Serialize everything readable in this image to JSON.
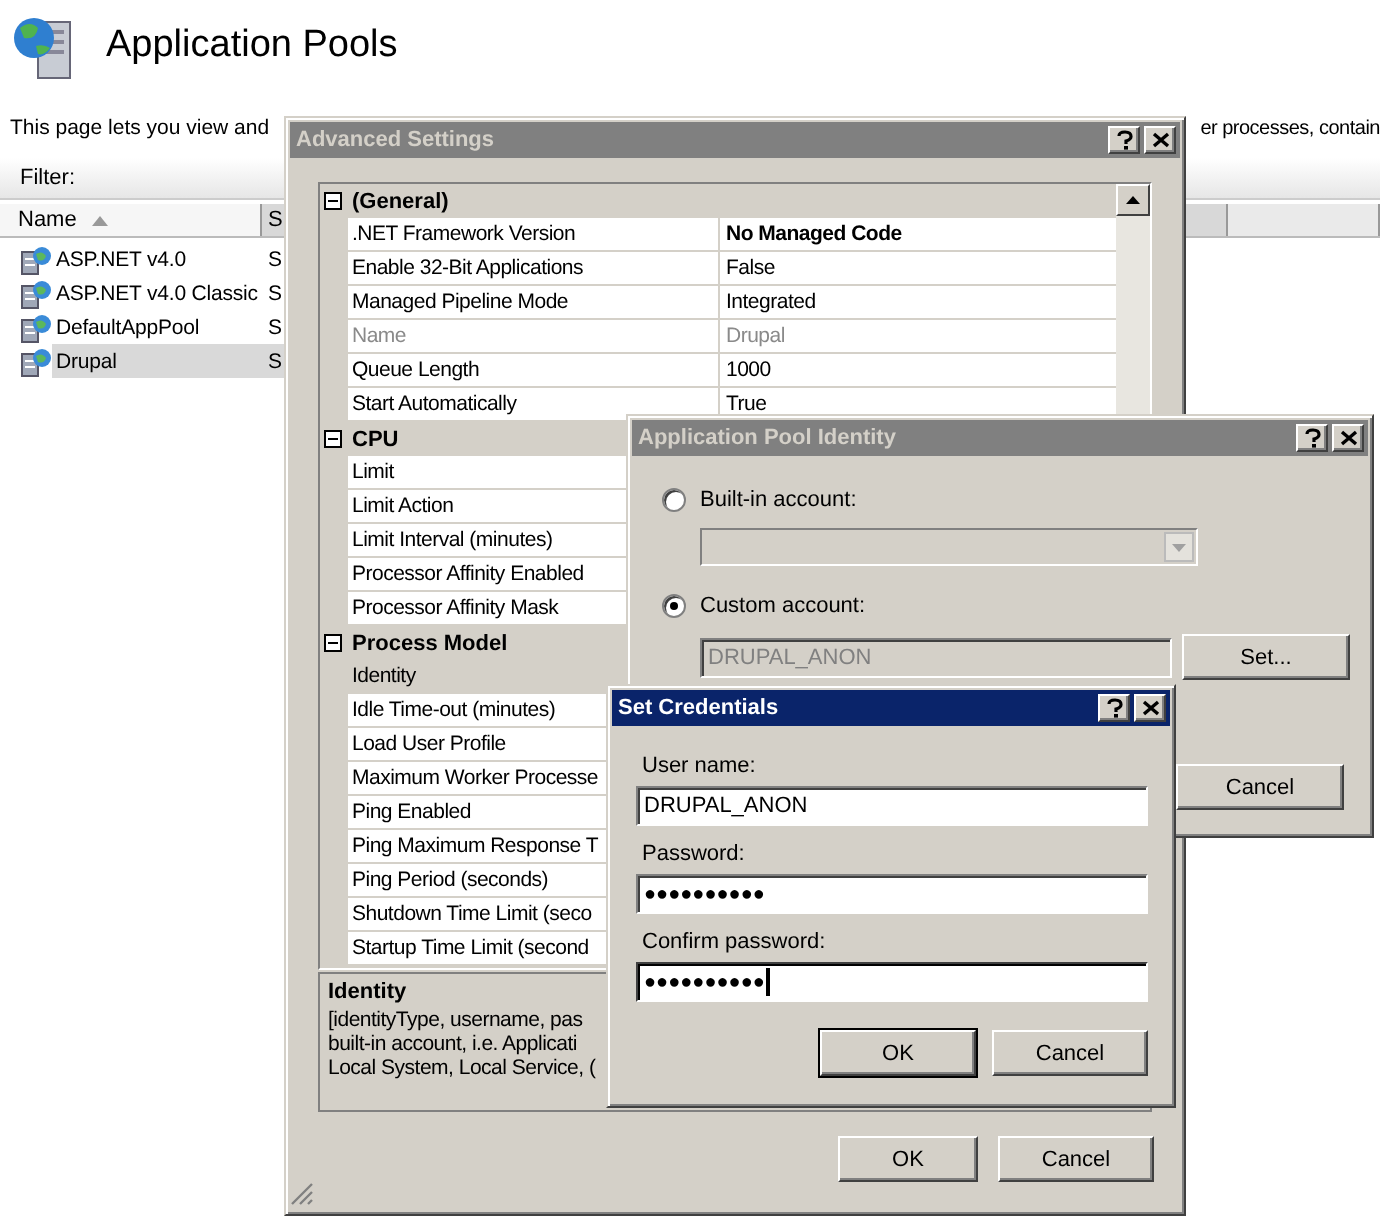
{
  "page": {
    "title": "Application Pools",
    "description_left": "This page lets you view and",
    "description_right": "er processes, contain",
    "filter_label": "Filter:"
  },
  "pool_list": {
    "columns": [
      {
        "label": "Name",
        "sorted": true
      },
      {
        "label": "S",
        "sorted": false
      }
    ],
    "rows": [
      {
        "name": "ASP.NET v4.0",
        "column_2": "S",
        "selected": false
      },
      {
        "name": "ASP.NET v4.0 Classic",
        "column_2": "S",
        "selected": false
      },
      {
        "name": "DefaultAppPool",
        "column_2": "S",
        "selected": false
      },
      {
        "name": "Drupal",
        "column_2": "S",
        "selected": true
      }
    ]
  },
  "advanced_settings": {
    "title": "Advanced Settings",
    "active": false,
    "categories": [
      {
        "name": "(General)",
        "expanded": true,
        "properties": [
          {
            "name": ".NET Framework Version",
            "value": "No Managed Code",
            "modified": true,
            "read_only": false,
            "selected": false
          },
          {
            "name": "Enable 32-Bit Applications",
            "value": "False",
            "modified": false,
            "read_only": false,
            "selected": false
          },
          {
            "name": "Managed Pipeline Mode",
            "value": "Integrated",
            "modified": false,
            "read_only": false,
            "selected": false
          },
          {
            "name": "Name",
            "value": "Drupal",
            "modified": false,
            "read_only": true,
            "selected": false
          },
          {
            "name": "Queue Length",
            "value": "1000",
            "modified": false,
            "read_only": false,
            "selected": false
          },
          {
            "name": "Start Automatically",
            "value": "True",
            "modified": false,
            "read_only": false,
            "selected": false
          }
        ]
      },
      {
        "name": "CPU",
        "expanded": true,
        "properties": [
          {
            "name": "Limit",
            "read_only": false,
            "selected": false
          },
          {
            "name": "Limit Action",
            "read_only": false,
            "selected": false
          },
          {
            "name": "Limit Interval (minutes)",
            "read_only": false,
            "selected": false
          },
          {
            "name": "Processor Affinity Enabled",
            "read_only": false,
            "selected": false
          },
          {
            "name": "Processor Affinity Mask",
            "read_only": false,
            "selected": false
          }
        ]
      },
      {
        "name": "Process Model",
        "expanded": true,
        "properties": [
          {
            "name": "Identity",
            "read_only": false,
            "selected": true
          },
          {
            "name": "Idle Time-out (minutes)",
            "read_only": false,
            "selected": false
          },
          {
            "name": "Load User Profile",
            "read_only": false,
            "selected": false
          },
          {
            "name": "Maximum Worker Processe",
            "read_only": false,
            "selected": false
          },
          {
            "name": "Ping Enabled",
            "read_only": false,
            "selected": false
          },
          {
            "name": "Ping Maximum Response T",
            "read_only": false,
            "selected": false
          },
          {
            "name": "Ping Period (seconds)",
            "read_only": false,
            "selected": false
          },
          {
            "name": "Shutdown Time Limit (seco",
            "read_only": false,
            "selected": false
          },
          {
            "name": "Startup Time Limit (second",
            "read_only": false,
            "selected": false
          }
        ]
      }
    ],
    "description": {
      "title": "Identity",
      "lines": [
        "[identityType, username, pas",
        "built-in account, i.e. Applicati",
        "Local System, Local Service, ("
      ]
    },
    "buttons": [
      "OK",
      "Cancel"
    ]
  },
  "identity_dialog": {
    "title": "Application Pool Identity",
    "active": false,
    "options": [
      {
        "kind": "dropdown",
        "label": "Built-in account:",
        "selected": false,
        "disabled": true
      },
      {
        "kind": "field",
        "label": "Custom account:",
        "selected": true,
        "disabled": true,
        "value": "DRUPAL_ANON"
      }
    ],
    "set_button": "Set...",
    "cancel_button": "Cancel"
  },
  "credentials_dialog": {
    "title": "Set Credentials",
    "active": true,
    "fields": [
      {
        "label": "User name:",
        "value": "DRUPAL_ANON",
        "focused": false
      },
      {
        "label": "Password:",
        "value": "●●●●●●●●●●",
        "focused": false
      },
      {
        "label": "Confirm password:",
        "value": "●●●●●●●●●●",
        "focused": true
      }
    ],
    "buttons": [
      {
        "label": "OK",
        "default": true
      },
      {
        "label": "Cancel",
        "default": false
      }
    ]
  }
}
